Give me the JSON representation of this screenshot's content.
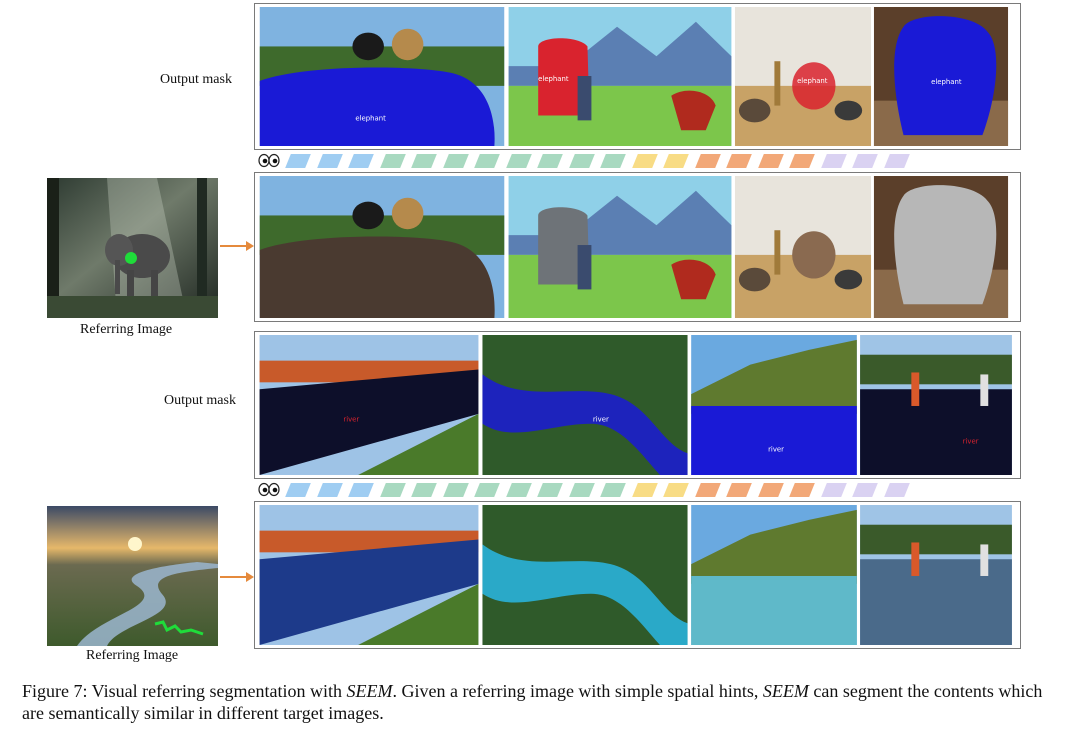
{
  "row_labels": {
    "top": "Output mask",
    "bottom": "Output mask"
  },
  "referring_labels": {
    "top": "Referring Image",
    "bottom": "Referring Image"
  },
  "mask_tags": {
    "elephant": [
      "elephant",
      "elephant",
      "elephant",
      "elephant"
    ],
    "river": [
      "river",
      "river",
      "river",
      "river"
    ]
  },
  "colors": {
    "panel_border": "#7a7a7a",
    "arrow": "#e58a3c",
    "mask_blue": "#1a1ad6",
    "mask_red": "#d9232e",
    "hint_dot": "#1fdc3a",
    "hint_scribble": "#1fdc3a",
    "strip": [
      "#9fcdf2",
      "#9fcdf2",
      "#9fcdf2",
      "#a8d9c0",
      "#a8d9c0",
      "#a8d9c0",
      "#a8d9c0",
      "#a8d9c0",
      "#a8d9c0",
      "#a8d9c0",
      "#a8d9c0",
      "#f8dc85",
      "#f8dc85",
      "#f2a878",
      "#f2a878",
      "#f2a878",
      "#f2a878",
      "#dad2f2",
      "#dad2f2",
      "#dad2f2"
    ]
  },
  "caption": {
    "prefix": "Figure 7: Visual referring segmentation with ",
    "model": "SEEM",
    "mid": ". Given a referring image with simple spatial hints, ",
    "model2": "SEEM",
    "suffix": " can segment the contents which are semantically similar in different target images."
  }
}
